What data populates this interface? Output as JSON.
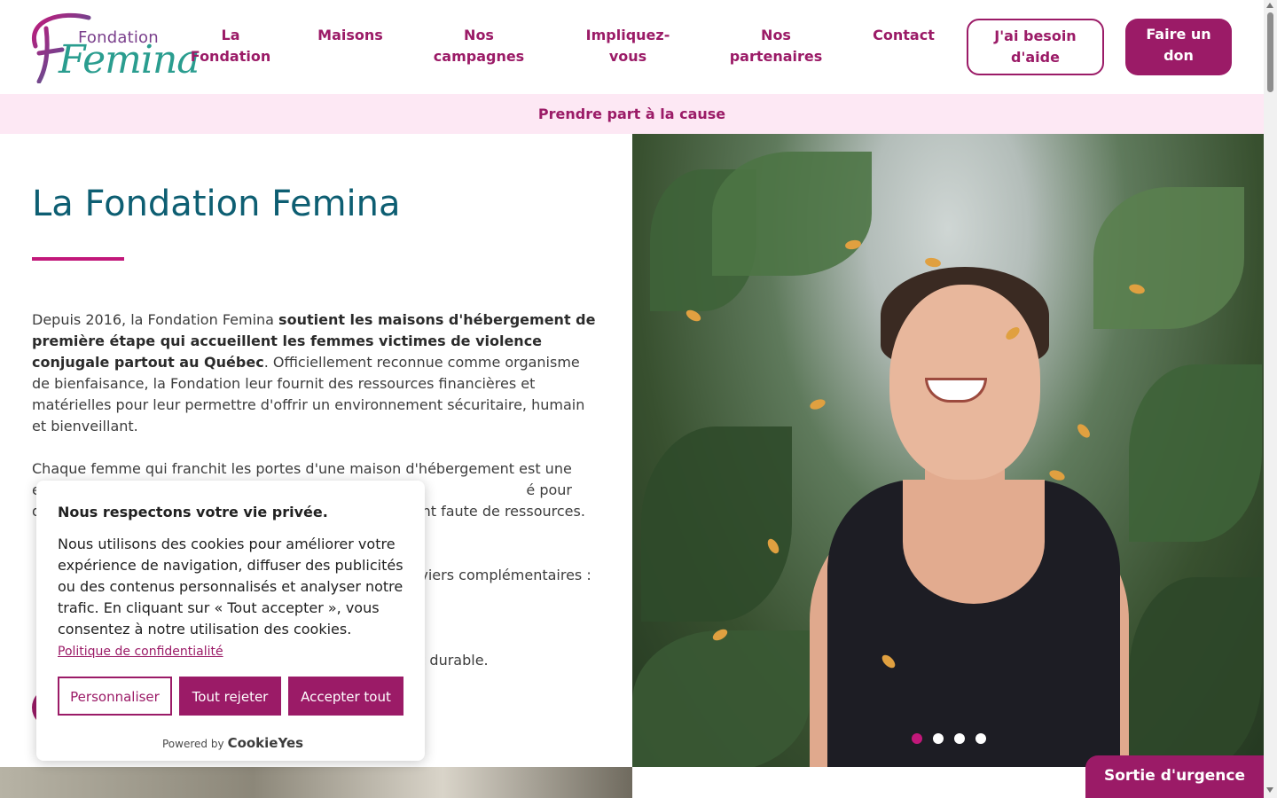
{
  "logo": {
    "small": "Fondation",
    "big": "Femina"
  },
  "nav": [
    {
      "line1": "La",
      "line2": "Fondation"
    },
    {
      "line1": "Maisons",
      "line2": ""
    },
    {
      "line1": "Nos",
      "line2": "campagnes"
    },
    {
      "line1": "Impliquez-",
      "line2": "vous"
    },
    {
      "line1": "Nos",
      "line2": "partenaires"
    },
    {
      "line1": "Contact",
      "line2": ""
    }
  ],
  "help_button": {
    "line1": "J'ai besoin",
    "line2": "d'aide"
  },
  "donate_button": {
    "line1": "Faire un",
    "line2": "don"
  },
  "banner": "Prendre part à la cause",
  "main": {
    "title": "La Fondation Femina",
    "p1_a": "Depuis 2016, la Fondation Femina ",
    "p1_b": "soutient les maisons d'hébergement de première étape qui accueillent les femmes victimes de violence conjugale partout au Québec",
    "p1_c": ". Officiellement reconnue comme organisme de bienfaisance, la Fondation leur fournit des ressources financières et matérielles pour leur permettre d'offrir un environnement sécuritaire, humain et bienveillant.",
    "p2": "Chaque femme qui franchit les portes d'une maison d'hébergement est une                                       emble, multiplions les                                                                           é pour qu'aucune                                                                      nt faute de ressources.",
    "p3": "                                                                                      viers complémentaires :",
    "p4": "                                                                                    et durable."
  },
  "carousel": {
    "slides": 4,
    "active": 1
  },
  "cookie": {
    "title": "Nous respectons votre vie privée.",
    "text": "Nous utilisons des cookies pour améliorer votre expérience de navigation, diffuser des publicités ou des contenus personnalisés et analyser notre trafic. En cliquant sur « Tout accepter », vous consentez à notre utilisation des cookies.",
    "policy_link": "Politique de confidentialité",
    "customize": "Personnaliser",
    "reject": "Tout rejeter",
    "accept": "Accepter tout",
    "powered_by": "Powered by",
    "brand": "CookieYes"
  },
  "exit_button": "Sortie d'urgence",
  "colors": {
    "brand": "#9b1b67",
    "accent": "#c2187a",
    "title": "#0d5e72",
    "banner_bg": "#fde8f4"
  }
}
